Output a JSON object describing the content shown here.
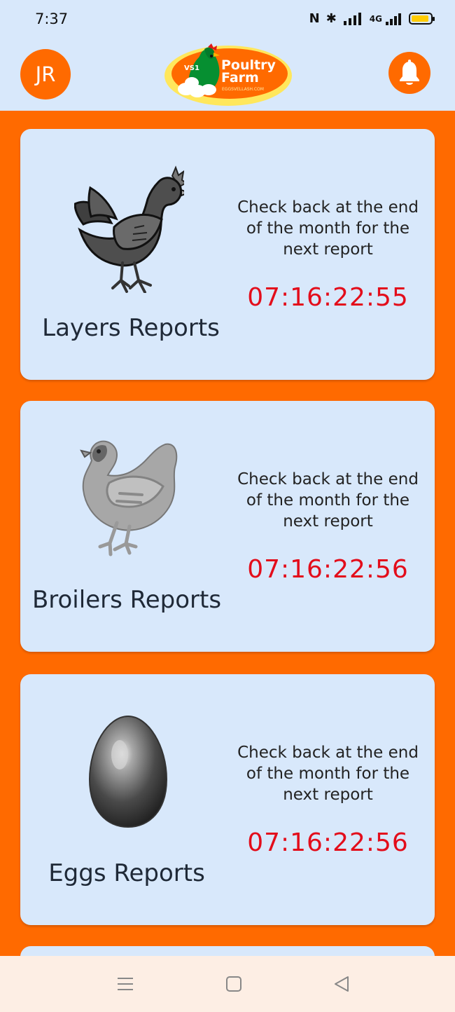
{
  "status_bar": {
    "time": "7:37",
    "network": "4G",
    "battery_color": "#ffcc00"
  },
  "header": {
    "avatar_initials": "JR",
    "logo": {
      "badge": "VS1",
      "title_line_1": "Poultry",
      "title_line_2": "Farm",
      "subtitle": "EGGSVELLASH.COM"
    },
    "notification_icon": "bell-icon"
  },
  "reports": [
    {
      "image": "layer-hen",
      "title": "Layers Reports",
      "message": "Check back at the end of the month for the next report",
      "countdown": "07:16:22:55"
    },
    {
      "image": "broiler-chicken",
      "title": "Broilers Reports",
      "message": "Check back at the end of the month for the next report",
      "countdown": "07:16:22:56"
    },
    {
      "image": "egg",
      "title": "Eggs Reports",
      "message": "Check back at the end of the month for the next report",
      "countdown": "07:16:22:56"
    }
  ],
  "colors": {
    "accent": "#ff6a00",
    "card_background": "#d8e8fb",
    "countdown": "#e30d1b",
    "navigation_background": "#fdeee4"
  },
  "navigation_bar": {
    "buttons": [
      "menu-icon",
      "home-square-icon",
      "back-triangle-icon"
    ]
  }
}
